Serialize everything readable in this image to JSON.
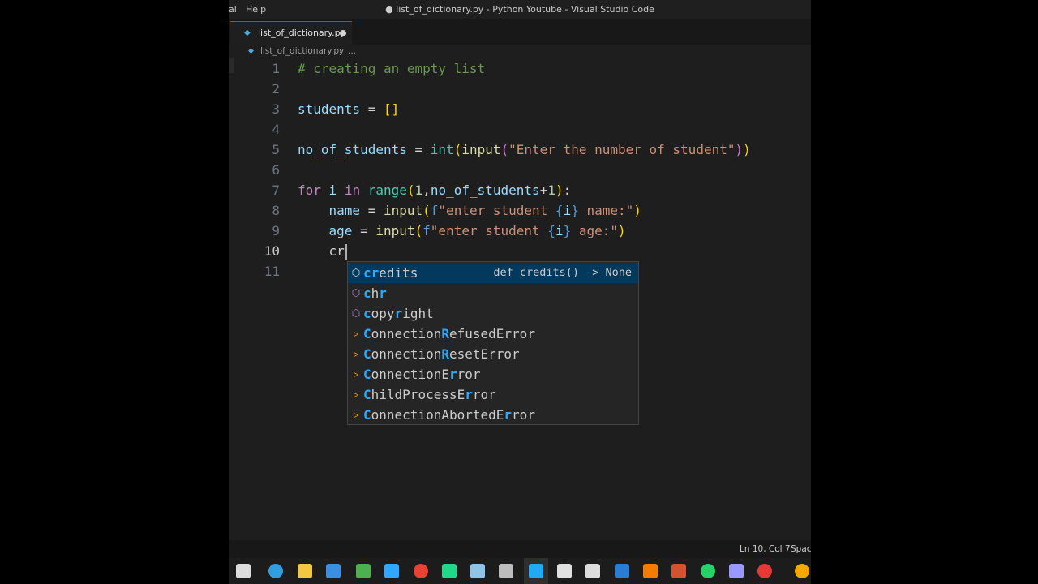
{
  "window": {
    "title": "● list_of_dictionary.py - Python Youtube - Visual Studio Code",
    "menu": [
      "al",
      "Help"
    ]
  },
  "tab": {
    "label": "list_of_dictionary.py"
  },
  "breadcrumb": {
    "file": "list_of_dictionary.py",
    "separator": "›",
    "more": "..."
  },
  "editor": {
    "line_numbers": [
      "1",
      "2",
      "3",
      "4",
      "5",
      "6",
      "7",
      "8",
      "9",
      "10",
      "11"
    ],
    "active_line": "10",
    "lines": [
      [
        {
          "t": "# creating an empty list",
          "c": "t-comment"
        }
      ],
      [],
      [
        {
          "t": "students",
          "c": "t-var"
        },
        {
          "t": " = ",
          "c": "t-plain"
        },
        {
          "t": "[]",
          "c": "t-bracket1"
        }
      ],
      [],
      [
        {
          "t": "no_of_students",
          "c": "t-var"
        },
        {
          "t": " = ",
          "c": "t-plain"
        },
        {
          "t": "int",
          "c": "t-func"
        },
        {
          "t": "(",
          "c": "t-bracket1"
        },
        {
          "t": "input",
          "c": "t-call"
        },
        {
          "t": "(",
          "c": "t-bracket2"
        },
        {
          "t": "\"Enter the number of student\"",
          "c": "t-string"
        },
        {
          "t": ")",
          "c": "t-bracket2"
        },
        {
          "t": ")",
          "c": "t-bracket1"
        }
      ],
      [],
      [
        {
          "t": "for",
          "c": "t-keyword"
        },
        {
          "t": " ",
          "c": "t-plain"
        },
        {
          "t": "i",
          "c": "t-var"
        },
        {
          "t": " ",
          "c": "t-plain"
        },
        {
          "t": "in",
          "c": "t-keyword"
        },
        {
          "t": " ",
          "c": "t-plain"
        },
        {
          "t": "range",
          "c": "t-func"
        },
        {
          "t": "(",
          "c": "t-bracket1"
        },
        {
          "t": "1",
          "c": "t-number"
        },
        {
          "t": ",",
          "c": "t-plain"
        },
        {
          "t": "no_of_students",
          "c": "t-var"
        },
        {
          "t": "+",
          "c": "t-plain"
        },
        {
          "t": "1",
          "c": "t-number"
        },
        {
          "t": ")",
          "c": "t-bracket1"
        },
        {
          "t": ":",
          "c": "t-plain"
        }
      ],
      [
        {
          "t": "    ",
          "c": "t-plain"
        },
        {
          "t": "name",
          "c": "t-var"
        },
        {
          "t": " = ",
          "c": "t-plain"
        },
        {
          "t": "input",
          "c": "t-call"
        },
        {
          "t": "(",
          "c": "t-bracket1"
        },
        {
          "t": "f",
          "c": "t-fprefix"
        },
        {
          "t": "\"enter student ",
          "c": "t-string"
        },
        {
          "t": "{",
          "c": "t-brace"
        },
        {
          "t": "i",
          "c": "t-var"
        },
        {
          "t": "}",
          "c": "t-brace"
        },
        {
          "t": " name:\"",
          "c": "t-string"
        },
        {
          "t": ")",
          "c": "t-bracket1"
        }
      ],
      [
        {
          "t": "    ",
          "c": "t-plain"
        },
        {
          "t": "age",
          "c": "t-var"
        },
        {
          "t": " = ",
          "c": "t-plain"
        },
        {
          "t": "input",
          "c": "t-call"
        },
        {
          "t": "(",
          "c": "t-bracket1"
        },
        {
          "t": "f",
          "c": "t-fprefix"
        },
        {
          "t": "\"enter student ",
          "c": "t-string"
        },
        {
          "t": "{",
          "c": "t-brace"
        },
        {
          "t": "i",
          "c": "t-var"
        },
        {
          "t": "}",
          "c": "t-brace"
        },
        {
          "t": " age:\"",
          "c": "t-string"
        },
        {
          "t": ")",
          "c": "t-bracket1"
        }
      ],
      [
        {
          "t": "    ",
          "c": "t-plain"
        },
        {
          "t": "cr",
          "c": "t-plain"
        }
      ],
      []
    ]
  },
  "suggestions": {
    "selected_detail": "def credits() -> None",
    "items": [
      {
        "kind": "cube",
        "parts": [
          {
            "t": "cr",
            "m": true
          },
          {
            "t": "edits",
            "m": false
          }
        ]
      },
      {
        "kind": "cube",
        "parts": [
          {
            "t": "c",
            "m": true
          },
          {
            "t": "h",
            "m": false
          },
          {
            "t": "r",
            "m": true
          }
        ]
      },
      {
        "kind": "cube",
        "parts": [
          {
            "t": "c",
            "m": true
          },
          {
            "t": "opy",
            "m": false
          },
          {
            "t": "r",
            "m": true
          },
          {
            "t": "ight",
            "m": false
          }
        ]
      },
      {
        "kind": "class",
        "parts": [
          {
            "t": "C",
            "m": true
          },
          {
            "t": "onnection",
            "m": false
          },
          {
            "t": "R",
            "m": true
          },
          {
            "t": "efusedError",
            "m": false
          }
        ]
      },
      {
        "kind": "class",
        "parts": [
          {
            "t": "C",
            "m": true
          },
          {
            "t": "onnection",
            "m": false
          },
          {
            "t": "R",
            "m": true
          },
          {
            "t": "esetError",
            "m": false
          }
        ]
      },
      {
        "kind": "class",
        "parts": [
          {
            "t": "C",
            "m": true
          },
          {
            "t": "onnectionE",
            "m": false
          },
          {
            "t": "r",
            "m": true
          },
          {
            "t": "ror",
            "m": false
          }
        ]
      },
      {
        "kind": "class",
        "parts": [
          {
            "t": "C",
            "m": true
          },
          {
            "t": "hildProcessE",
            "m": false
          },
          {
            "t": "r",
            "m": true
          },
          {
            "t": "ror",
            "m": false
          }
        ]
      },
      {
        "kind": "class",
        "parts": [
          {
            "t": "C",
            "m": true
          },
          {
            "t": "onnectionAbortedE",
            "m": false
          },
          {
            "t": "r",
            "m": true
          },
          {
            "t": "ror",
            "m": false
          }
        ]
      }
    ]
  },
  "status": {
    "position": "Ln 10, Col 7",
    "spaces": "Spac"
  },
  "taskbar": {
    "icons": [
      {
        "name": "task-view-icon",
        "color": "#dddddd"
      },
      {
        "name": "edge-icon",
        "color": "#2f9fe0"
      },
      {
        "name": "file-explorer-icon",
        "color": "#f2c744"
      },
      {
        "name": "store-icon",
        "color": "#3a8fe0"
      },
      {
        "name": "gamepad-icon",
        "color": "#4caf50"
      },
      {
        "name": "photoshop-icon",
        "color": "#31a8ff"
      },
      {
        "name": "chrome-icon",
        "color": "#e94235"
      },
      {
        "name": "pycharm-icon",
        "color": "#21d789"
      },
      {
        "name": "paint-icon",
        "color": "#8fc3e8"
      },
      {
        "name": "database-icon",
        "color": "#bdbdbd"
      },
      {
        "name": "vscode-icon",
        "color": "#23a9f2"
      },
      {
        "name": "clapper-icon",
        "color": "#e0e0e0"
      },
      {
        "name": "mail-icon",
        "color": "#dddddd"
      },
      {
        "name": "word-icon",
        "color": "#2b7cd3"
      },
      {
        "name": "orange-app-icon",
        "color": "#f57c00"
      },
      {
        "name": "powerpoint-icon",
        "color": "#d35230"
      },
      {
        "name": "whatsapp-icon",
        "color": "#25d366"
      },
      {
        "name": "premiere-icon",
        "color": "#9999ff"
      },
      {
        "name": "recorder-icon",
        "color": "#e53935"
      },
      {
        "name": "profile-icon",
        "color": "#f6a700"
      }
    ]
  }
}
